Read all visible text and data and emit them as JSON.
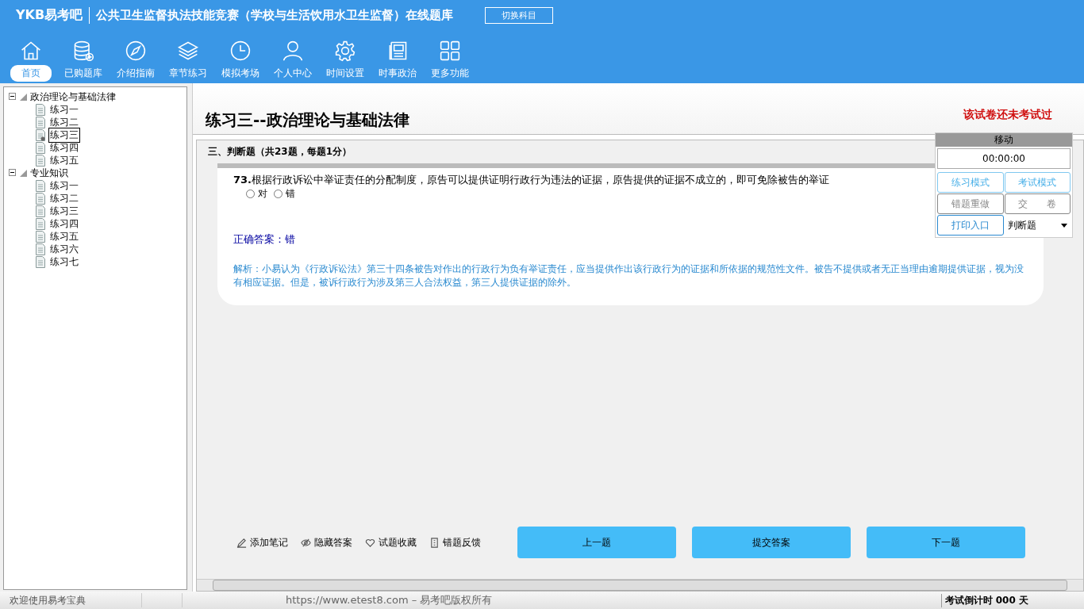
{
  "header": {
    "logo": "YKB易考吧",
    "title": "公共卫生监督执法技能竞赛（学校与生活饮用水卫生监督）在线题库",
    "switch_button": "切换科目"
  },
  "toolbar": [
    {
      "label": "首页",
      "kind": "home",
      "selected": true
    },
    {
      "label": "已购题库",
      "kind": "database",
      "selected": false
    },
    {
      "label": "介绍指南",
      "kind": "compass",
      "selected": false
    },
    {
      "label": "章节练习",
      "kind": "layers",
      "selected": false
    },
    {
      "label": "模拟考场",
      "kind": "clock",
      "selected": false
    },
    {
      "label": "个人中心",
      "kind": "user",
      "selected": false
    },
    {
      "label": "时间设置",
      "kind": "gear",
      "selected": false
    },
    {
      "label": "时事政治",
      "kind": "news",
      "selected": false
    },
    {
      "label": "更多功能",
      "kind": "grid",
      "selected": false
    }
  ],
  "tree": [
    {
      "label": "政治理论与基础法律",
      "expanded": true,
      "children": [
        {
          "label": "练习一",
          "selected": false
        },
        {
          "label": "练习二",
          "selected": false
        },
        {
          "label": "练习三",
          "selected": true
        },
        {
          "label": "练习四",
          "selected": false
        },
        {
          "label": "练习五",
          "selected": false
        }
      ]
    },
    {
      "label": "专业知识",
      "expanded": true,
      "children": [
        {
          "label": "练习一",
          "selected": false
        },
        {
          "label": "练习二",
          "selected": false
        },
        {
          "label": "练习三",
          "selected": false
        },
        {
          "label": "练习四",
          "selected": false
        },
        {
          "label": "练习五",
          "selected": false
        },
        {
          "label": "练习六",
          "selected": false
        },
        {
          "label": "练习七",
          "selected": false
        }
      ]
    }
  ],
  "exam": {
    "title": "练习三--政治理论与基础法律",
    "status": "该试卷还未考试过",
    "section": "三、判断题（共23题，每题1分）",
    "question": {
      "number": "73.",
      "text": "根据行政诉讼中举证责任的分配制度，原告可以提供证明行政行为违法的证据，原告提供的证据不成立的，即可免除被告的举证",
      "options": [
        {
          "label": "对",
          "selected": false
        },
        {
          "label": "错",
          "selected": false
        }
      ],
      "answer": "正确答案：错",
      "explanation": "解析：小易认为《行政诉讼法》第三十四条被告对作出的行政行为负有举证责任，应当提供作出该行政行为的证据和所依据的规范性文件。被告不提供或者无正当理由逾期提供证据，视为没有相应证据。但是，被诉行政行为涉及第三人合法权益，第三人提供证据的除外。"
    }
  },
  "side_panel": {
    "title": "移动",
    "timer": "00:00:00",
    "buttons": [
      {
        "label": "练习模式",
        "kind": "blue"
      },
      {
        "label": "考试模式",
        "kind": "blue"
      },
      {
        "label": "错题重做",
        "kind": "grey"
      },
      {
        "label": "交　　卷",
        "kind": "grey"
      },
      {
        "label": "打印入口",
        "kind": "primary"
      }
    ],
    "type_select": "判断题"
  },
  "actions": [
    {
      "label": "添加笔记",
      "kind": "pencil"
    },
    {
      "label": "隐藏答案",
      "kind": "eye"
    },
    {
      "label": "试题收藏",
      "kind": "heart"
    },
    {
      "label": "错题反馈",
      "kind": "doc"
    }
  ],
  "nav_buttons": [
    "上一题",
    "提交答案",
    "下一题"
  ],
  "status_bar": {
    "welcome": "欢迎使用易考宝典",
    "copyright": "https://www.etest8.com – 易考吧版权所有",
    "countdown": "考试倒计时 000 天"
  }
}
